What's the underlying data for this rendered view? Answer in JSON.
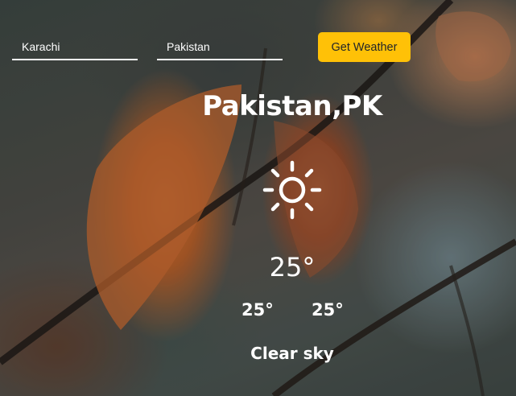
{
  "form": {
    "city_value": "Karachi",
    "country_value": "Pakistan",
    "button_label": "Get Weather"
  },
  "weather": {
    "location": "Pakistan,PK",
    "icon": "sun-icon",
    "temperature": "25°",
    "temp_min": "25°",
    "temp_max": "25°",
    "description": "Clear sky"
  },
  "colors": {
    "button": "#ffc107",
    "text": "#ffffff"
  }
}
